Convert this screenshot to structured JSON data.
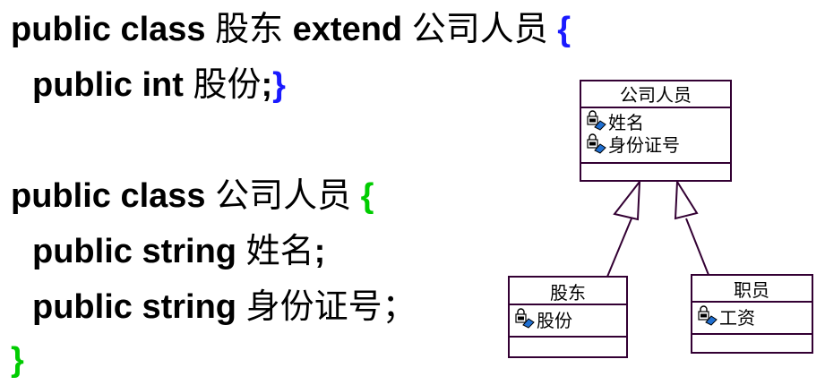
{
  "code": {
    "l1_kw": "public class ",
    "l1_name": "股东",
    "l1_ext": " extend ",
    "l1_base": "公司人员",
    "l1_brace": " {",
    "l2_kw": "public int ",
    "l2_name": "股份",
    "l2_semi": ";",
    "l2_brace": "}",
    "l3_kw": "public class ",
    "l3_name": "公司人员",
    "l3_brace": " {",
    "l4_kw": "public string ",
    "l4_name": "姓名",
    "l4_semi": ";",
    "l5_kw": "public string ",
    "l5_name": "身份证号",
    "l5_semi": "；",
    "l6_brace": "}"
  },
  "uml": {
    "base": {
      "name": "公司人员",
      "attributes": [
        "姓名",
        "身份证号"
      ]
    },
    "left_child": {
      "name": "股东",
      "attributes": [
        "股份"
      ]
    },
    "right_child": {
      "name": "职员",
      "attributes": [
        "工资"
      ]
    },
    "icon": "lock-attribute-icon"
  },
  "colors": {
    "brace_blue": "#1a1aff",
    "brace_green": "#00cc00",
    "uml_stroke": "#330033"
  }
}
